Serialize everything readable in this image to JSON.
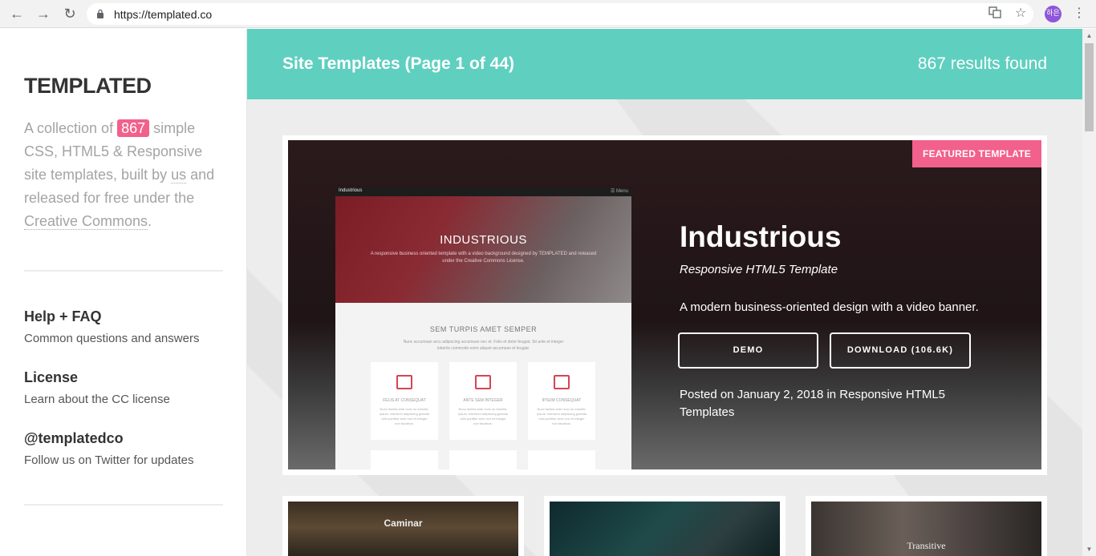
{
  "browser": {
    "url": "https://templated.co",
    "back_icon": "arrow-left-icon",
    "forward_icon": "arrow-right-icon",
    "reload_icon": "reload-icon",
    "avatar_text": "하은"
  },
  "sidebar": {
    "brand": "TEMPLATED",
    "intro_prefix": "A collection of",
    "count": "867",
    "intro_mid": "simple CSS, HTML5 & Responsive site templates, built by",
    "us_link": "us",
    "intro_mid2": "and released for free under the",
    "cc_link": "Creative Commons",
    "intro_end": ".",
    "items": [
      {
        "title": "Help + FAQ",
        "desc": "Common questions and answers"
      },
      {
        "title": "License",
        "desc": "Learn about the CC license"
      },
      {
        "title": "@templatedco",
        "desc": "Follow us on Twitter for updates"
      }
    ]
  },
  "banner": {
    "title": "Site Templates (Page 1 of 44)",
    "count": "867 results found"
  },
  "featured": {
    "tag": "FEATURED TEMPLATE",
    "name": "Industrious",
    "type": "Responsive HTML5 Template",
    "description": "A modern business-oriented design with a video banner.",
    "demo_label": "DEMO",
    "download_label": "DOWNLOAD (106.6K)",
    "posted": "Posted on January 2, 2018 in Responsive HTML5 Templates",
    "preview": {
      "bar_name": "Industrious",
      "bar_menu": "☰ Menu",
      "title": "INDUSTRIOUS",
      "subtitle": "A responsive business oriented template with a video background designed by TEMPLATED and released under the Creative Commons License.",
      "section": "SEM TURPIS AMET SEMPER",
      "section_sub": "Nunc accumsan arcu adipiscing accumsan nec et. Felis et dolor feugiat. Sit ante et integer lobortis commodo enim aliquet accumsan et feugiat.",
      "cards": [
        {
          "label": "FELIS AT CONSEQUAT",
          "text": "Nunc lacinia ante nunc ac lobortis. Ipsum. interdum adipiscing gravida odio porttitor sem non mi integer non faucibus."
        },
        {
          "label": "ANTE SEM INTEGER",
          "text": "Nunc lacinia ante nunc ac lobortis. Ipsum. interdum adipiscing gravida odio porttitor sem non mi integer non faucibus."
        },
        {
          "label": "IPSUM CONSEQUAT",
          "text": "Nunc lacinia ante nunc ac lobortis. Ipsum. interdum adipiscing gravida odio porttitor sem non mi integer non faucibus."
        }
      ]
    }
  },
  "thumbnails": [
    {
      "title": "Caminar"
    },
    {
      "title": ""
    },
    {
      "title": "Transitive"
    }
  ],
  "colors": {
    "teal": "#5fcfc0",
    "pink": "#f2608c"
  }
}
